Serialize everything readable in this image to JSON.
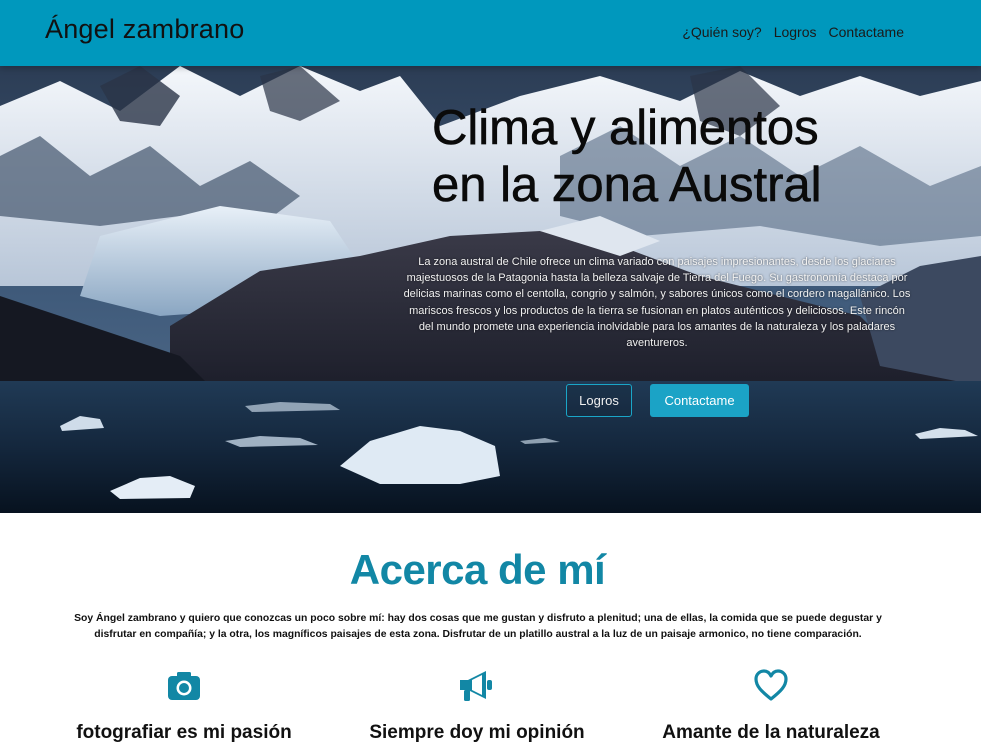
{
  "navbar": {
    "brand": "Ángel zambrano",
    "links": [
      "¿Quién soy?",
      "Logros",
      "Contactame"
    ]
  },
  "hero": {
    "title_line1": "Clima y alimentos",
    "title_line2": "en la zona Austral",
    "description": "La zona austral de Chile ofrece un clima variado con paisajes impresionantes, desde los glaciares majestuosos de la Patagonia hasta la belleza salvaje de Tierra del Fuego. Su gastronomía destaca por delicias marinas como el centolla, congrio y salmón, y sabores únicos como el cordero magallánico. Los mariscos frescos y los productos de la tierra se fusionan en platos auténticos y deliciosos. Este rincón del mundo promete una experiencia inolvidable para los amantes de la naturaleza y los paladares aventureros.",
    "button_outline": "Logros",
    "button_solid": "Contactame",
    "background": "mountain-glacier-landscape"
  },
  "about": {
    "title": "Acerca de mí",
    "text": "Soy Ángel zambrano y quiero que conozcas un poco sobre mí: hay dos cosas que me gustan y disfruto a plenitud; una de ellas, la comida que se puede degustar y disfrutar en compañía; y la otra, los magníficos paisajes de esta zona. Disfrutar de un platillo austral a la luz de un paisaje armonico, no tiene comparación.",
    "features": [
      {
        "icon": "camera-icon",
        "title": "fotografiar es mi pasión"
      },
      {
        "icon": "megaphone-icon",
        "title": "Siempre doy mi opinión"
      },
      {
        "icon": "heart-icon",
        "title": "Amante de la naturaleza"
      }
    ]
  },
  "colors": {
    "navbar": "#0098bd",
    "accent": "#1287a5",
    "button": "#1ba3c6"
  }
}
